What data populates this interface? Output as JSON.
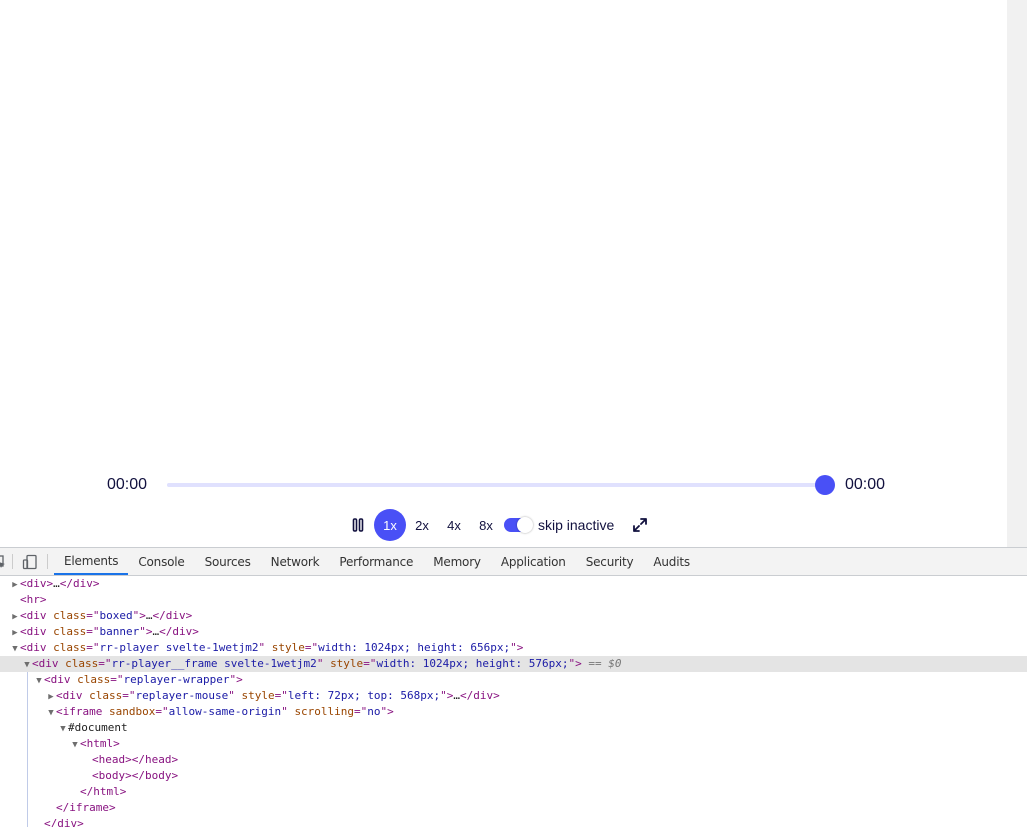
{
  "player": {
    "current_time": "00:00",
    "total_time": "00:00",
    "progress_fraction": 1.0,
    "speeds": [
      "1x",
      "2x",
      "4x",
      "8x"
    ],
    "active_speed": "1x",
    "skip_inactive_label": "skip inactive",
    "skip_inactive_on": true,
    "accent_color": "#4950f6"
  },
  "devtools": {
    "tabs": [
      "Elements",
      "Console",
      "Sources",
      "Network",
      "Performance",
      "Memory",
      "Application",
      "Security",
      "Audits"
    ],
    "active_tab": "Elements",
    "dom_lines": [
      {
        "indent": 0,
        "toggle": "collapsed",
        "parts": [
          [
            "tag",
            "<div>"
          ],
          [
            "dim",
            "…"
          ],
          [
            "tag",
            "</div>"
          ]
        ]
      },
      {
        "indent": 0,
        "toggle": "none",
        "parts": [
          [
            "tag",
            "<hr>"
          ]
        ]
      },
      {
        "indent": 0,
        "toggle": "collapsed",
        "parts": [
          [
            "tag",
            "<div "
          ],
          [
            "attr",
            "class"
          ],
          [
            "punc",
            "=\""
          ],
          [
            "val",
            "boxed"
          ],
          [
            "punc",
            "\">"
          ],
          [
            "dim",
            "…"
          ],
          [
            "tag",
            "</div>"
          ]
        ]
      },
      {
        "indent": 0,
        "toggle": "collapsed",
        "parts": [
          [
            "tag",
            "<div "
          ],
          [
            "attr",
            "class"
          ],
          [
            "punc",
            "=\""
          ],
          [
            "val",
            "banner"
          ],
          [
            "punc",
            "\">"
          ],
          [
            "dim",
            "…"
          ],
          [
            "tag",
            "</div>"
          ]
        ]
      },
      {
        "indent": 0,
        "toggle": "expanded",
        "parts": [
          [
            "tag",
            "<div "
          ],
          [
            "attr",
            "class"
          ],
          [
            "punc",
            "=\""
          ],
          [
            "val",
            "rr-player svelte-1wetjm2"
          ],
          [
            "punc",
            "\" "
          ],
          [
            "attr",
            "style"
          ],
          [
            "punc",
            "=\""
          ],
          [
            "val",
            "width: 1024px; height: 656px;"
          ],
          [
            "punc",
            "\">"
          ]
        ]
      },
      {
        "indent": 1,
        "toggle": "expanded",
        "selected": true,
        "parts": [
          [
            "tag",
            "<div "
          ],
          [
            "attr",
            "class"
          ],
          [
            "punc",
            "=\""
          ],
          [
            "val",
            "rr-player__frame svelte-1wetjm2"
          ],
          [
            "punc",
            "\" "
          ],
          [
            "attr",
            "style"
          ],
          [
            "punc",
            "=\""
          ],
          [
            "val",
            "width: 1024px; height: 576px;"
          ],
          [
            "punc",
            "\">"
          ],
          [
            "marker",
            " == $0"
          ]
        ]
      },
      {
        "indent": 2,
        "toggle": "expanded",
        "parts": [
          [
            "tag",
            "<div "
          ],
          [
            "attr",
            "class"
          ],
          [
            "punc",
            "=\""
          ],
          [
            "val",
            "replayer-wrapper"
          ],
          [
            "punc",
            "\">"
          ]
        ]
      },
      {
        "indent": 3,
        "toggle": "collapsed",
        "parts": [
          [
            "tag",
            "<div "
          ],
          [
            "attr",
            "class"
          ],
          [
            "punc",
            "=\""
          ],
          [
            "val",
            "replayer-mouse"
          ],
          [
            "punc",
            "\" "
          ],
          [
            "attr",
            "style"
          ],
          [
            "punc",
            "=\""
          ],
          [
            "val",
            "left: 72px; top: 568px;"
          ],
          [
            "punc",
            "\">"
          ],
          [
            "dim",
            "…"
          ],
          [
            "tag",
            "</div>"
          ]
        ]
      },
      {
        "indent": 3,
        "toggle": "expanded",
        "parts": [
          [
            "tag",
            "<iframe "
          ],
          [
            "attr",
            "sandbox"
          ],
          [
            "punc",
            "=\""
          ],
          [
            "val",
            "allow-same-origin"
          ],
          [
            "punc",
            "\" "
          ],
          [
            "attr",
            "scrolling"
          ],
          [
            "punc",
            "=\""
          ],
          [
            "val",
            "no"
          ],
          [
            "punc",
            "\">"
          ]
        ]
      },
      {
        "indent": 4,
        "toggle": "expanded",
        "parts": [
          [
            "dim",
            "#document"
          ]
        ]
      },
      {
        "indent": 5,
        "toggle": "expanded",
        "parts": [
          [
            "tag",
            "<html>"
          ]
        ]
      },
      {
        "indent": 6,
        "toggle": "none",
        "parts": [
          [
            "tag",
            "<head></head>"
          ]
        ]
      },
      {
        "indent": 6,
        "toggle": "none",
        "parts": [
          [
            "tag",
            "<body></body>"
          ]
        ]
      },
      {
        "indent": 5,
        "toggle": "none",
        "parts": [
          [
            "tag",
            "</html>"
          ]
        ]
      },
      {
        "indent": 3,
        "toggle": "none",
        "parts": [
          [
            "tag",
            "</iframe>"
          ]
        ]
      },
      {
        "indent": 2,
        "toggle": "none",
        "parts": [
          [
            "tag",
            "</div>"
          ]
        ]
      }
    ]
  }
}
